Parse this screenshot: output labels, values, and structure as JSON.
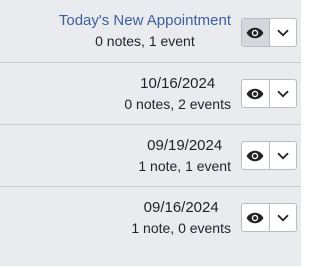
{
  "rows": [
    {
      "title": "Today's New Appointment",
      "subtitle": "0 notes,  1 event",
      "title_is_link": true,
      "view_pressed": true
    },
    {
      "title": "10/16/2024",
      "subtitle": "0 notes,  2 events",
      "title_is_link": false,
      "view_pressed": false
    },
    {
      "title": "09/19/2024",
      "subtitle": "1 note,  1 event",
      "title_is_link": false,
      "view_pressed": false
    },
    {
      "title": "09/16/2024",
      "subtitle": "1 note,  0 events",
      "title_is_link": false,
      "view_pressed": false
    }
  ],
  "icons": {
    "view": "eye-icon",
    "expand": "chevron-down-icon"
  },
  "colors": {
    "background": "#e9ebee",
    "link": "#3e5f9e",
    "text": "#1f2328",
    "button_border": "#b9bdc3",
    "button_pressed": "#d4d7dc"
  }
}
